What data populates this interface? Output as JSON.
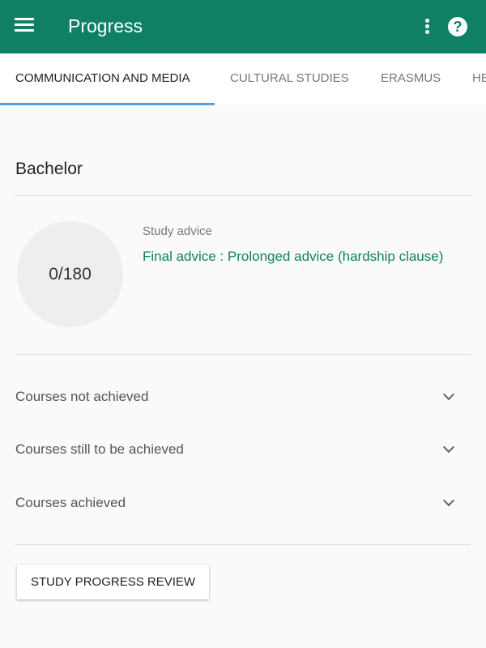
{
  "appbar": {
    "title": "Progress",
    "menu_icon": "hamburger-icon",
    "more_icon": "more-vert-icon",
    "help_icon": "help-icon",
    "color": "#108064"
  },
  "tabs": [
    {
      "label": "COMMUNICATION AND MEDIA",
      "active": true
    },
    {
      "label": "CULTURAL STUDIES"
    },
    {
      "label": "ERASMUS"
    },
    {
      "label": "HE"
    }
  ],
  "section": {
    "title": "Bachelor",
    "credits": "0/180",
    "advice_label": "Study advice",
    "advice": "Final advice : Prolonged advice (hardship clause)"
  },
  "rows": [
    {
      "label": "Courses not achieved"
    },
    {
      "label": "Courses still to be achieved"
    },
    {
      "label": "Courses achieved"
    }
  ],
  "button": {
    "label": "STUDY PROGRESS REVIEW"
  }
}
